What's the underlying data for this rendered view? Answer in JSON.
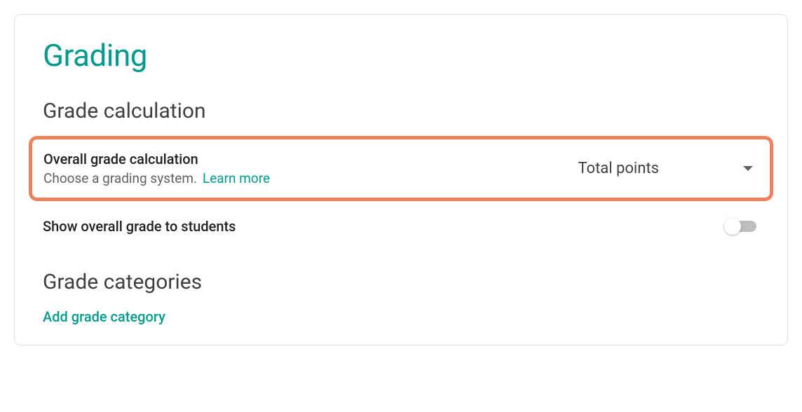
{
  "page": {
    "title": "Grading"
  },
  "sections": {
    "calculation": {
      "heading": "Grade calculation",
      "overall": {
        "title": "Overall grade calculation",
        "subtitle": "Choose a grading system.",
        "learnMore": "Learn more",
        "dropdownValue": "Total points"
      },
      "showToStudents": {
        "label": "Show overall grade to students",
        "enabled": false
      }
    },
    "categories": {
      "heading": "Grade categories",
      "addLink": "Add grade category"
    }
  }
}
